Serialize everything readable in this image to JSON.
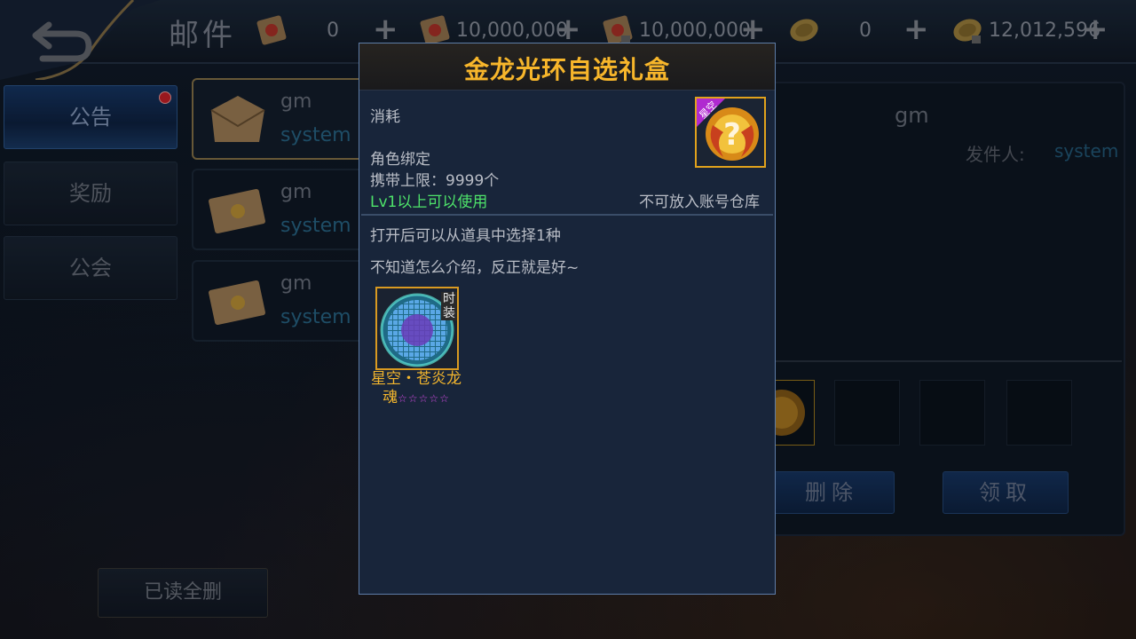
{
  "header": {
    "title": "邮件",
    "resources": [
      {
        "icon": "red-scroll-icon",
        "value": "0"
      },
      {
        "icon": "red-scroll-icon",
        "value": "10,000,000"
      },
      {
        "icon": "red-scroll-lock-icon",
        "value": "10,000,000"
      },
      {
        "icon": "gold-coin-icon",
        "value": "0"
      },
      {
        "icon": "gold-coin-lock-icon",
        "value": "12,012,596"
      }
    ],
    "plus_label": "+"
  },
  "tabs": [
    {
      "label": "公告",
      "active": true,
      "has_dot": true
    },
    {
      "label": "奖励",
      "active": false,
      "has_dot": false
    },
    {
      "label": "公会",
      "active": false,
      "has_dot": false
    }
  ],
  "mail_list": [
    {
      "sender": "gm",
      "from": "system",
      "selected": true
    },
    {
      "sender": "gm",
      "from": "system",
      "selected": false
    },
    {
      "sender": "gm",
      "from": "system",
      "selected": false
    }
  ],
  "detail": {
    "title": "gm",
    "sender_label": "发件人:",
    "sender": "system",
    "delete_label": "删除",
    "claim_label": "领取"
  },
  "bottom": {
    "read_delete_all": "已读全删"
  },
  "popup": {
    "title": "金龙光环自选礼盒",
    "type_label": "消耗",
    "bind_label": "角色绑定",
    "carry_limit": "携带上限：9999个",
    "level_req": "Lv1以上可以使用",
    "warehouse_note": "不可放入账号仓库",
    "item_badge": "星空",
    "desc_line1": "打开后可以从道具中选择1种",
    "desc_line2": "不知道怎么介绍，反正就是好~",
    "reward": {
      "tag": "时装",
      "name": "星空・苍炎龙魂",
      "stars": "☆☆☆☆☆"
    }
  },
  "colors": {
    "title_gold": "#f7b62b",
    "green": "#4ee36a",
    "system_blue": "#2a6b8e",
    "notify_red": "#d4222a"
  }
}
